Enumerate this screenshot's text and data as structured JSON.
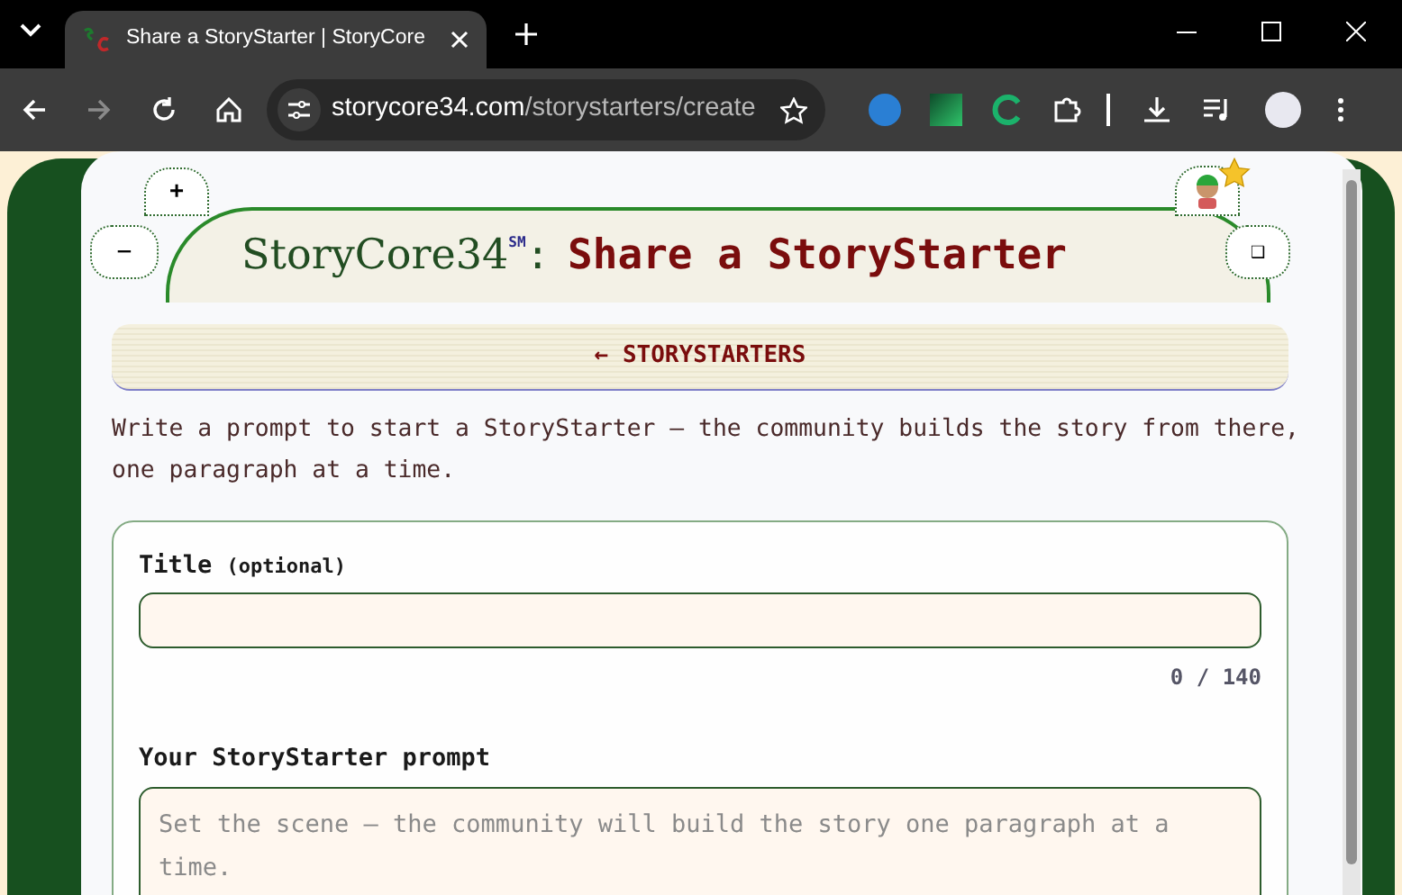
{
  "browser": {
    "tab_title": "Share a StoryStarter | StoryCore",
    "url_host": "storycore34.com",
    "url_path": "/storystarters/create"
  },
  "header": {
    "plus_button": "+",
    "minus_button": "−",
    "square_button": "❑",
    "brand": "StoryCore34",
    "brand_mark": "SM",
    "separator": ":",
    "page_title": "Share a StoryStarter"
  },
  "back_link": "← STORYSTARTERS",
  "intro": "Write a prompt to start a StoryStarter — the community builds the story from there, one paragraph at a time.",
  "form": {
    "fields": [
      {
        "kind": "input",
        "label": "Title",
        "label_note": "(optional)",
        "counter": "0 / 140"
      },
      {
        "kind": "textarea",
        "label": "Your StoryStarter prompt",
        "placeholder": "Set the scene — the community will build the story one paragraph at a time."
      }
    ]
  }
}
